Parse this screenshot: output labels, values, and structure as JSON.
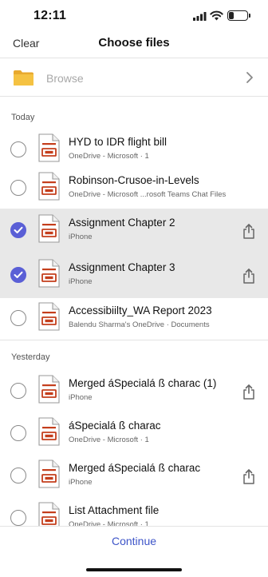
{
  "status_bar": {
    "time": "12:11",
    "battery": "30",
    "battery_level": 0.3
  },
  "nav": {
    "clear_label": "Clear",
    "title": "Choose files"
  },
  "browse": {
    "label": "Browse"
  },
  "sections": {
    "today": "Today",
    "yesterday": "Yesterday"
  },
  "files": [
    {
      "name": "HYD to IDR flight bill",
      "meta": "OneDrive - Microsoft · 1",
      "selected": false,
      "share": false
    },
    {
      "name": "Robinson-Crusoe-in-Levels",
      "meta": "OneDrive - Microsoft ...rosoft Teams Chat Files",
      "selected": false,
      "share": false
    },
    {
      "name": "Assignment Chapter 2",
      "meta": "iPhone",
      "selected": true,
      "share": true
    },
    {
      "name": "Assignment Chapter 3",
      "meta": "iPhone",
      "selected": true,
      "share": true
    },
    {
      "name": "Accessibiilty_WA Report 2023",
      "meta": "Balendu Sharma's OneDrive · Documents",
      "selected": false,
      "share": false
    },
    {
      "name": "Merged áSpecialá ß charac (1)",
      "meta": "iPhone",
      "selected": false,
      "share": true
    },
    {
      "name": "áSpecialá ß charac",
      "meta": "OneDrive - Microsoft · 1",
      "selected": false,
      "share": false
    },
    {
      "name": "Merged áSpecialá ß charac",
      "meta": "iPhone",
      "selected": false,
      "share": true
    },
    {
      "name": "List Attachment file",
      "meta": "OneDrive - Microsoft · 1",
      "selected": false,
      "share": false
    }
  ],
  "icons": {
    "folder": "folder-icon",
    "document": "document-icon",
    "share": "share-icon",
    "chevron": "chevron-right-icon"
  },
  "colors": {
    "accent": "#5a5fd6",
    "link": "#3d54c8",
    "folder": "#f5c242",
    "doc_accent": "#c43e1c",
    "selected_row": "#e8e8e8"
  },
  "footer": {
    "continue_label": "Continue"
  }
}
